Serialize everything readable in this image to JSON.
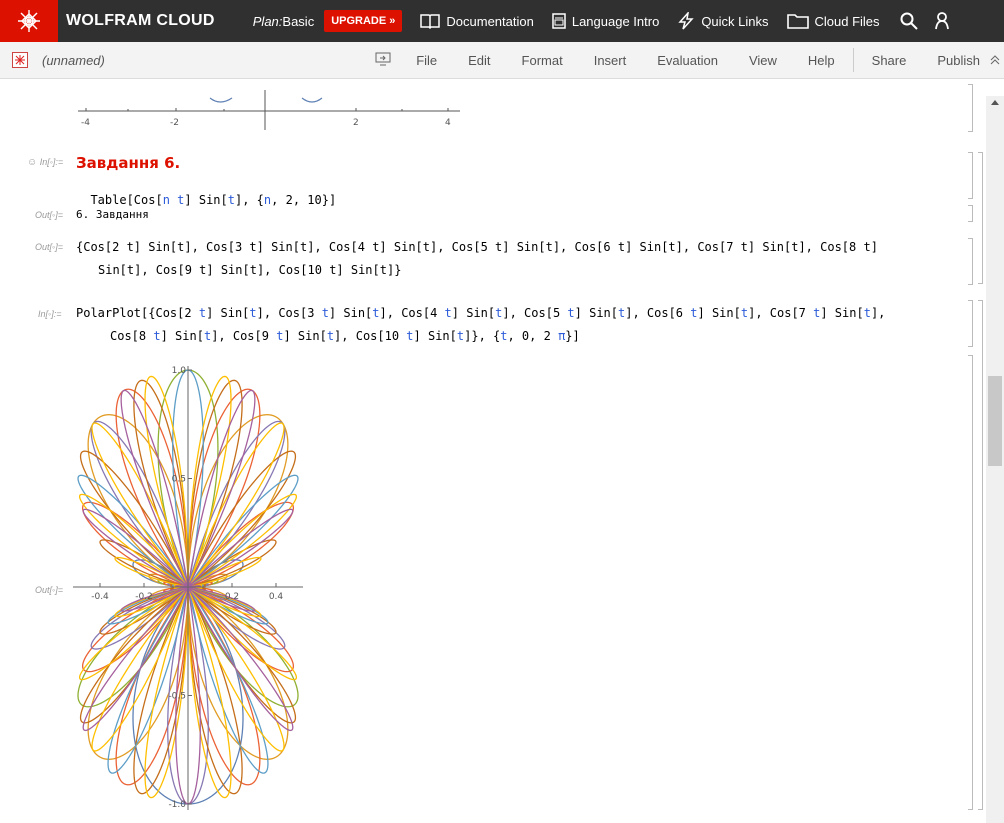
{
  "topbar": {
    "brand": "WOLFRAM CLOUD",
    "plan_label": "Plan:",
    "plan_value": "Basic",
    "upgrade": "UPGRADE »",
    "documentation": "Documentation",
    "language_intro": "Language Intro",
    "quick_links": "Quick Links",
    "cloud_files": "Cloud Files"
  },
  "menubar": {
    "notebook_name": "(unnamed)",
    "items": [
      "File",
      "Edit",
      "Format",
      "Insert",
      "Evaluation",
      "View",
      "Help"
    ],
    "share": "Share",
    "publish": "Publish"
  },
  "top_plot_ticks": [
    "-4",
    "-2",
    "2",
    "4"
  ],
  "cells": {
    "in1_label": "In[◦]:=",
    "heading": "Завдання 6.",
    "table_input": [
      "Table[Cos[",
      "n",
      " ",
      "t",
      "] Sin[",
      "t",
      "], {",
      "n",
      ", 2, 10}]"
    ],
    "out1_label": "Out[◦]=",
    "out1": "6. Завдання",
    "out2_label": "Out[◦]=",
    "out2_line1": "{Cos[2 t] Sin[t], Cos[3 t] Sin[t], Cos[4 t] Sin[t], Cos[5 t] Sin[t], Cos[6 t] Sin[t], Cos[7 t] Sin[t], Cos[8 t]",
    "out2_line2": "Sin[t], Cos[9 t] Sin[t], Cos[10 t] Sin[t]}",
    "in2_label": "In[◦]:=",
    "polar_line1": [
      "PolarPlot[{Cos[2 ",
      "t",
      "] Sin[",
      "t",
      "], Cos[3 ",
      "t",
      "] Sin[",
      "t",
      "], Cos[4 ",
      "t",
      "] Sin[",
      "t",
      "], Cos[5 ",
      "t",
      "] Sin[",
      "t",
      "], Cos[6 ",
      "t",
      "] Sin[",
      "t",
      "], Cos[7 ",
      "t",
      "] Sin[",
      "t",
      "],"
    ],
    "polar_line2": [
      "Cos[8 ",
      "t",
      "] Sin[",
      "t",
      "], Cos[9 ",
      "t",
      "] Sin[",
      "t",
      "], Cos[10 ",
      "t",
      "] Sin[",
      "t",
      "]}, {",
      "t",
      ", 0, 2 ",
      "π",
      "}]"
    ],
    "out3_label": "Out[◦]="
  },
  "chart_data": {
    "type": "line",
    "plot_kind": "polar",
    "series": [
      {
        "name": "Cos[2 t] Sin[t]",
        "n": 2
      },
      {
        "name": "Cos[3 t] Sin[t]",
        "n": 3
      },
      {
        "name": "Cos[4 t] Sin[t]",
        "n": 4
      },
      {
        "name": "Cos[5 t] Sin[t]",
        "n": 5
      },
      {
        "name": "Cos[6 t] Sin[t]",
        "n": 6
      },
      {
        "name": "Cos[7 t] Sin[t]",
        "n": 7
      },
      {
        "name": "Cos[8 t] Sin[t]",
        "n": 8
      },
      {
        "name": "Cos[9 t] Sin[t]",
        "n": 9
      },
      {
        "name": "Cos[10 t] Sin[t]",
        "n": 10
      }
    ],
    "t_range": [
      0,
      6.283185307
    ],
    "xlim": [
      -0.5,
      0.5
    ],
    "ylim": [
      -1.0,
      1.0
    ],
    "xticks": [
      -0.4,
      -0.2,
      0.2,
      0.4
    ],
    "xtick_labels": [
      "-0.4",
      "-0.2",
      "0.2",
      "0.4"
    ],
    "yticks": [
      1.0,
      0.5,
      -0.5,
      -1.0
    ],
    "ytick_labels": [
      "1.0",
      "0.5",
      "-0.5",
      "-1.0"
    ],
    "colors": [
      "#5e81b5",
      "#e19c24",
      "#8fb032",
      "#eb6235",
      "#8778b3",
      "#c56e1a",
      "#5d9ec7",
      "#ffbf00",
      "#a5609d"
    ]
  }
}
